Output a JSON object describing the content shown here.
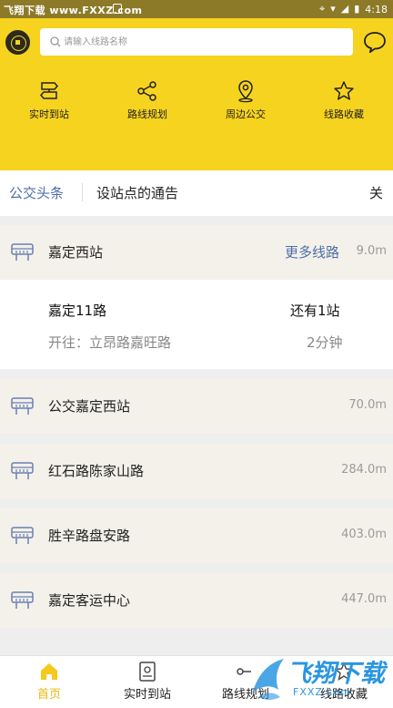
{
  "status_bar": {
    "watermark": "飞翔下载 www.FXXZ.com",
    "time": "4:18"
  },
  "header": {
    "logo_icon": "bus-logo-icon",
    "search_placeholder": "请输入线路名称",
    "chat_icon": "chat-bubble-icon",
    "brand_color": "#f6d31f"
  },
  "quick_actions": [
    {
      "label": "实时到站",
      "icon": "signpost-icon"
    },
    {
      "label": "路线规划",
      "icon": "route-share-icon"
    },
    {
      "label": "周边公交",
      "icon": "location-pin-icon"
    },
    {
      "label": "线路收藏",
      "icon": "star-icon"
    }
  ],
  "news": {
    "tag": "公交头条",
    "text": "设站点的通告",
    "close_label": "关"
  },
  "nearest_station": {
    "name": "嘉定西站",
    "more_label": "更多线路",
    "distance": "9.0m"
  },
  "line_card": {
    "name": "嘉定11路",
    "stops_left": "还有1站",
    "direction": "开往：立昂路嘉旺路",
    "eta": "2分钟"
  },
  "stations": [
    {
      "name": "公交嘉定西站",
      "distance": "70.0m"
    },
    {
      "name": "红石路陈家山路",
      "distance": "284.0m"
    },
    {
      "name": "胜辛路盘安路",
      "distance": "403.0m"
    },
    {
      "name": "嘉定客运中心",
      "distance": "447.0m"
    }
  ],
  "tabs": [
    {
      "label": "首页",
      "icon": "home-icon",
      "active": true
    },
    {
      "label": "实时到站",
      "icon": "bus-stop-card-icon",
      "active": false
    },
    {
      "label": "路线规划",
      "icon": "route-icon",
      "active": false
    },
    {
      "label": "线路收藏",
      "icon": "favorite-icon",
      "active": false
    }
  ],
  "watermark_logo": {
    "text": "飞翔下载",
    "sub": "FXXZ.com"
  },
  "colors": {
    "accent": "#f6d31f",
    "link": "#4e6ea8",
    "active_tab": "#e7b90f"
  }
}
